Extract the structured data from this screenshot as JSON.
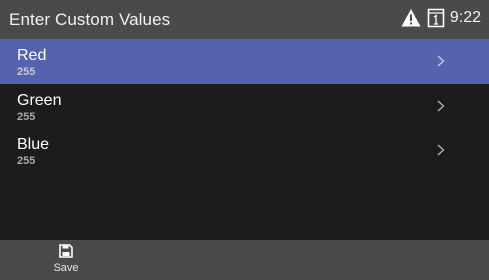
{
  "header": {
    "title": "Enter Custom Values",
    "icons": [
      "warning-icon",
      "sd-card-icon"
    ],
    "time": "9:22"
  },
  "list": {
    "items": [
      {
        "label": "Red",
        "value": "255",
        "selected": true
      },
      {
        "label": "Green",
        "value": "255",
        "selected": false
      },
      {
        "label": "Blue",
        "value": "255",
        "selected": false
      }
    ]
  },
  "footer": {
    "save_label": "Save",
    "save_icon": "floppy-disk-icon"
  },
  "colors": {
    "status_bar": "#4a4a4a",
    "background": "#1c1c1c",
    "selection": "#5563ae"
  }
}
